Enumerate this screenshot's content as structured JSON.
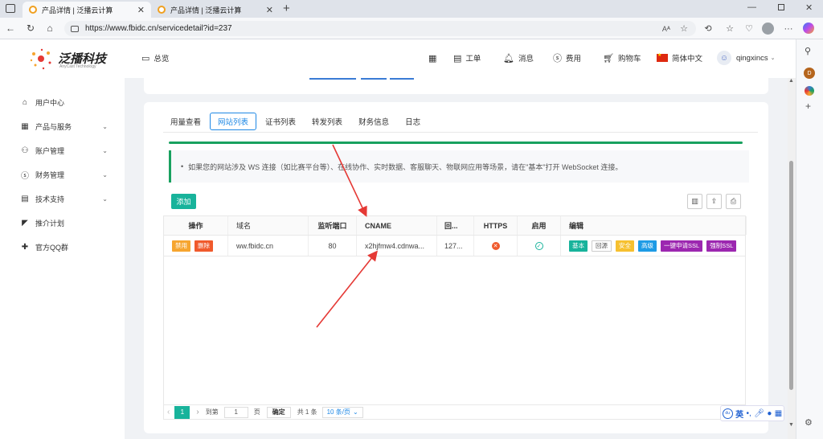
{
  "browser": {
    "tabs": [
      {
        "title": "产品详情 | 泛播云计算",
        "active": true
      },
      {
        "title": "产品详情 | 泛播云计算",
        "active": false
      }
    ],
    "url": "https://www.fbidc.cn/servicedetail?id=237",
    "edge_avatar_letter": "D"
  },
  "header": {
    "logo_name": "泛播科技",
    "logo_sub": "AnyCast Technology",
    "overview": "总览",
    "ticket": "工单",
    "messages": "消息",
    "billing": "费用",
    "cart": "购物车",
    "language": "简体中文",
    "username": "qingxincs"
  },
  "sidebar": {
    "items": [
      {
        "label": "用户中心",
        "icon": "home-icon"
      },
      {
        "label": "产品与服务",
        "icon": "grid-icon",
        "expandable": true
      },
      {
        "label": "账户管理",
        "icon": "user-icon",
        "expandable": true
      },
      {
        "label": "财务管理",
        "icon": "dollar-icon",
        "expandable": true
      },
      {
        "label": "技术支持",
        "icon": "list-icon",
        "expandable": true
      },
      {
        "label": "推介计划",
        "icon": "send-icon"
      },
      {
        "label": "官方QQ群",
        "icon": "plus-icon"
      }
    ]
  },
  "main": {
    "tabs": [
      "用量查看",
      "网站列表",
      "证书列表",
      "转发列表",
      "财务信息",
      "日志"
    ],
    "active_tab": "网站列表",
    "notice": "如果您的网站涉及 WS 连接（如比赛平台等）、在线协作、实时数据、客服聊天、物联网应用等场景，请在\"基本\"打开 WebSocket 连接。",
    "add_button": "添加",
    "table": {
      "columns": [
        "操作",
        "域名",
        "监听端口",
        "CNAME",
        "回...",
        "HTTPS",
        "启用",
        "编辑"
      ],
      "rows": [
        {
          "actions": [
            "禁用",
            "删除"
          ],
          "domain": "ww.fbidc.cn",
          "port": "80",
          "cname": "x2hjfmw4.cdnwa...",
          "origin": "127...",
          "https": false,
          "enabled": true,
          "edit_buttons": [
            "基本",
            "回源",
            "安全",
            "高级",
            "一键申请SSL",
            "强制SSL"
          ]
        }
      ]
    },
    "pagination": {
      "current": "1",
      "goto_label": "到第",
      "goto_value": "1",
      "page_unit": "页",
      "confirm": "确定",
      "total": "共 1 条",
      "page_size": "10 条/页"
    }
  },
  "ime": {
    "mode": "英"
  },
  "colors": {
    "primary_green": "#18b39b",
    "accent_blue": "#1e88e5",
    "notice_green": "#19a15f",
    "annotation_red": "#e53935"
  }
}
